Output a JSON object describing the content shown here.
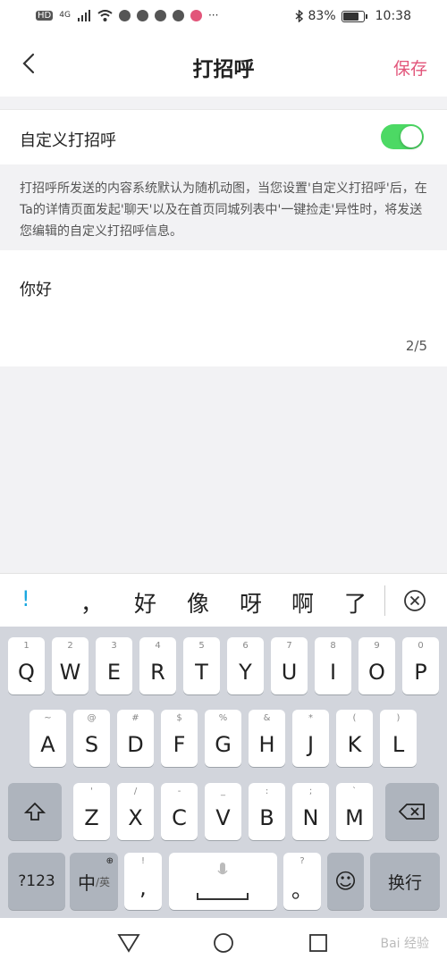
{
  "status": {
    "left_badges": [
      "HD",
      "4G"
    ],
    "battery_text": "83%",
    "battery_level": 0.83,
    "time": "10:38",
    "more": "···"
  },
  "nav": {
    "title": "打招呼",
    "save_label": "保存"
  },
  "toggle": {
    "label": "自定义打招呼",
    "on": true,
    "on_color": "#4cd964"
  },
  "description": "打招呼所发送的内容系统默认为随机动图，当您设置'自定义打招呼'后，在Ta的详情页面发起'聊天'以及在首页同城列表中'一键捡走'异性时，将发送您编辑的自定义打招呼信息。",
  "editor": {
    "value": "你好",
    "counter": "2/5"
  },
  "candidates": [
    "!",
    "，",
    "好",
    "像",
    "呀",
    "啊",
    "了"
  ],
  "keyboard": {
    "row1": [
      {
        "hint": "1",
        "key": "Q"
      },
      {
        "hint": "2",
        "key": "W"
      },
      {
        "hint": "3",
        "key": "E"
      },
      {
        "hint": "4",
        "key": "R"
      },
      {
        "hint": "5",
        "key": "T"
      },
      {
        "hint": "6",
        "key": "Y"
      },
      {
        "hint": "7",
        "key": "U"
      },
      {
        "hint": "8",
        "key": "I"
      },
      {
        "hint": "9",
        "key": "O"
      },
      {
        "hint": "0",
        "key": "P"
      }
    ],
    "row2": [
      {
        "hint": "~",
        "key": "A"
      },
      {
        "hint": "@",
        "key": "S"
      },
      {
        "hint": "#",
        "key": "D"
      },
      {
        "hint": "$",
        "key": "F"
      },
      {
        "hint": "%",
        "key": "G"
      },
      {
        "hint": "&",
        "key": "H"
      },
      {
        "hint": "*",
        "key": "J"
      },
      {
        "hint": "(",
        "key": "K"
      },
      {
        "hint": ")",
        "key": "L"
      }
    ],
    "row3": [
      {
        "hint": "'",
        "key": "Z"
      },
      {
        "hint": "/",
        "key": "X"
      },
      {
        "hint": "-",
        "key": "C"
      },
      {
        "hint": "_",
        "key": "V"
      },
      {
        "hint": ":",
        "key": "B"
      },
      {
        "hint": ";",
        "key": "N"
      },
      {
        "hint": "`",
        "key": "M"
      }
    ],
    "symbols_label": "?123",
    "lang_main": "中",
    "lang_alt": "/英",
    "punct_hint": "!",
    "punct_key": ",",
    "punct2_hint": "?",
    "punct2_key": "。",
    "enter_label": "换行"
  },
  "watermark": "Bai 经验"
}
